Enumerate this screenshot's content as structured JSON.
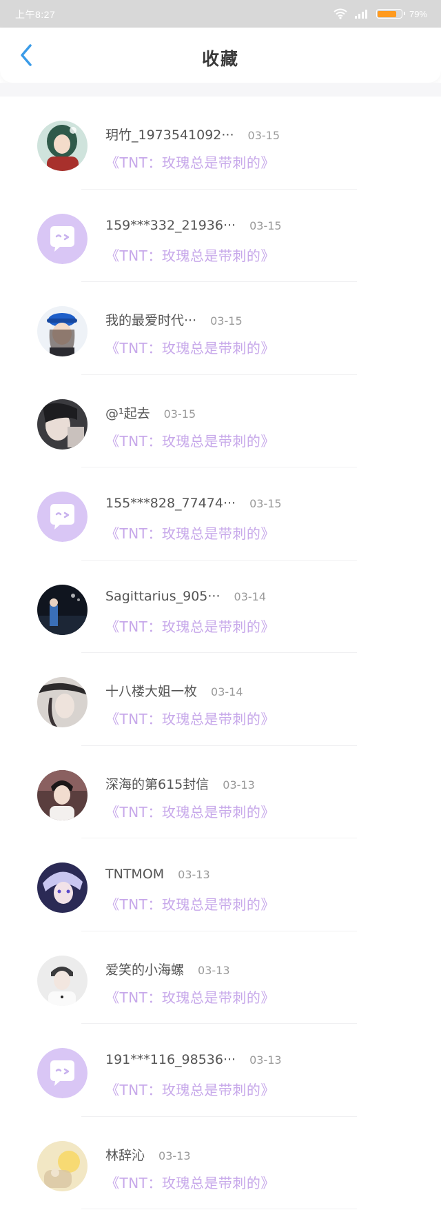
{
  "status_bar": {
    "time": "上午8:27",
    "battery_text": "79%",
    "battery_level": 0.79,
    "battery_color": "#ff9a1f"
  },
  "header": {
    "title": "收藏",
    "back_icon": "chevron-left-icon",
    "accent": "#3a9be8"
  },
  "items": [
    {
      "name": "玥竹_1973541092···",
      "date": "03-15",
      "post": "《TNT：玫瑰总是带刺的》",
      "avatar": "photo-girl-green-hair"
    },
    {
      "name": "159***332_21936···",
      "date": "03-15",
      "post": "《TNT：玫瑰总是带刺的》",
      "avatar": "default-chat-bubble-avatar"
    },
    {
      "name": "我的最爱时代···",
      "date": "03-15",
      "post": "《TNT：玫瑰总是带刺的》",
      "avatar": "photo-girl-blue-cap"
    },
    {
      "name": "@¹起去",
      "date": "03-15",
      "post": "《TNT：玫瑰总是带刺的》",
      "avatar": "photo-dark-portrait"
    },
    {
      "name": "155***828_77474···",
      "date": "03-15",
      "post": "《TNT：玫瑰总是带刺的》",
      "avatar": "default-chat-bubble-avatar"
    },
    {
      "name": "Sagittarius_905···",
      "date": "03-14",
      "post": "《TNT：玫瑰总是带刺的》",
      "avatar": "photo-night-stage"
    },
    {
      "name": "十八楼大姐一枚",
      "date": "03-14",
      "post": "《TNT：玫瑰总是带刺的》",
      "avatar": "photo-hat-portrait"
    },
    {
      "name": "深海的第615封信",
      "date": "03-13",
      "post": "《TNT：玫瑰总是带刺的》",
      "avatar": "photo-boy-pink"
    },
    {
      "name": "TNTMOM",
      "date": "03-13",
      "post": "《TNT：玫瑰总是带刺的》",
      "avatar": "photo-anime-boy"
    },
    {
      "name": "爱笑的小海螺",
      "date": "03-13",
      "post": "《TNT：玫瑰总是带刺的》",
      "avatar": "photo-boy-white"
    },
    {
      "name": "191***116_98536···",
      "date": "03-13",
      "post": "《TNT：玫瑰总是带刺的》",
      "avatar": "default-chat-bubble-avatar"
    },
    {
      "name": "林辞沁",
      "date": "03-13",
      "post": "《TNT：玫瑰总是带刺的》",
      "avatar": "photo-yellow-light"
    }
  ],
  "colors": {
    "post_title": "#c7a8ea",
    "default_avatar_bg": "#d9c6f5"
  }
}
